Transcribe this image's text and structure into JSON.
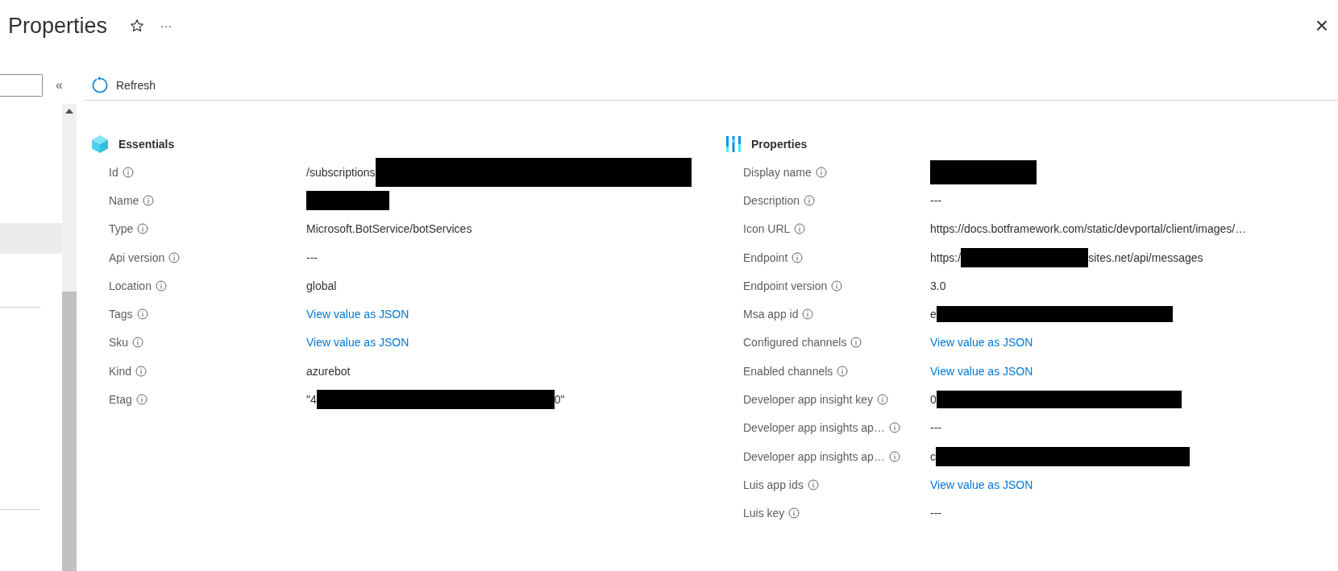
{
  "header": {
    "title": "Properties",
    "more": "···",
    "close": "×"
  },
  "sidebar": {
    "collapse": "«"
  },
  "toolbar": {
    "refresh": "Refresh"
  },
  "sections": [
    {
      "kind": "essentials",
      "title": "Essentials",
      "rows": [
        {
          "label": "Id",
          "value": [
            {
              "kind": "text",
              "text": "/subscriptions"
            },
            {
              "kind": "redaction"
            }
          ]
        },
        {
          "label": "Name",
          "value": [
            {
              "kind": "redaction"
            }
          ]
        },
        {
          "label": "Type",
          "value": [
            {
              "kind": "text",
              "text": "Microsoft.BotService/botServices"
            }
          ]
        },
        {
          "label": "Api version",
          "value": [
            {
              "kind": "text",
              "text": "---"
            }
          ]
        },
        {
          "label": "Location",
          "value": [
            {
              "kind": "text",
              "text": "global"
            }
          ]
        },
        {
          "label": "Tags",
          "value": [
            {
              "kind": "link",
              "text": "View value as JSON"
            }
          ]
        },
        {
          "label": "Sku",
          "value": [
            {
              "kind": "link",
              "text": "View value as JSON"
            }
          ]
        },
        {
          "label": "Kind",
          "value": [
            {
              "kind": "text",
              "text": "azurebot"
            }
          ]
        },
        {
          "label": "Etag",
          "value": [
            {
              "kind": "text",
              "text": "\"4"
            },
            {
              "kind": "redaction"
            },
            {
              "kind": "text",
              "text": "0\""
            }
          ]
        }
      ]
    },
    {
      "kind": "properties",
      "title": "Properties",
      "rows": [
        {
          "label": "Display name",
          "value": [
            {
              "kind": "redaction"
            }
          ]
        },
        {
          "label": "Description",
          "value": [
            {
              "kind": "text",
              "text": "---"
            }
          ]
        },
        {
          "label": "Icon URL",
          "value": [
            {
              "kind": "text",
              "text": "https://docs.botframework.com/static/devportal/client/images/…"
            }
          ]
        },
        {
          "label": "Endpoint",
          "value": [
            {
              "kind": "text",
              "text": "https:/"
            },
            {
              "kind": "redaction"
            },
            {
              "kind": "text",
              "text": "sites.net/api/messages"
            }
          ]
        },
        {
          "label": "Endpoint version",
          "value": [
            {
              "kind": "text",
              "text": "3.0"
            }
          ]
        },
        {
          "label": "Msa app id",
          "value": [
            {
              "kind": "text",
              "text": "e"
            },
            {
              "kind": "redaction"
            }
          ]
        },
        {
          "label": "Configured channels",
          "value": [
            {
              "kind": "link",
              "text": "View value as JSON"
            }
          ]
        },
        {
          "label": "Enabled channels",
          "value": [
            {
              "kind": "link",
              "text": "View value as JSON"
            }
          ]
        },
        {
          "label": "Developer app insight key",
          "value": [
            {
              "kind": "text",
              "text": "0"
            },
            {
              "kind": "redaction"
            }
          ]
        },
        {
          "label": "Developer app insights ap…",
          "value": [
            {
              "kind": "text",
              "text": "---"
            }
          ]
        },
        {
          "label": "Developer app insights ap…",
          "value": [
            {
              "kind": "text",
              "text": "c"
            },
            {
              "kind": "redaction"
            }
          ]
        },
        {
          "label": "Luis app ids",
          "value": [
            {
              "kind": "link",
              "text": "View value as JSON"
            }
          ]
        },
        {
          "label": "Luis key",
          "value": [
            {
              "kind": "text",
              "text": "---"
            }
          ]
        }
      ]
    }
  ]
}
